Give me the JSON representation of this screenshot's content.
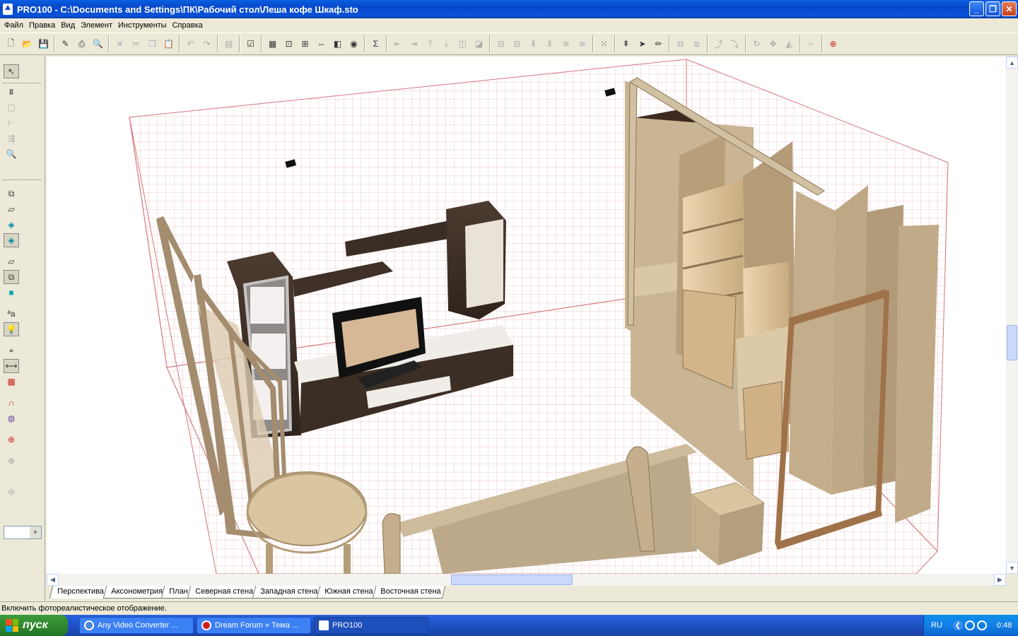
{
  "window": {
    "title": "PRO100 - C:\\Documents and Settings\\ПК\\Рабочий стол\\Леша кофе Шкаф.sto",
    "min_glyph": "_",
    "max_glyph": "❐",
    "close_glyph": "✕"
  },
  "menu": [
    "Файл",
    "Правка",
    "Вид",
    "Элемент",
    "Инструменты",
    "Справка"
  ],
  "view_tabs": [
    {
      "label": "Перспектива",
      "active": true
    },
    {
      "label": "Аксонометрия",
      "active": false
    },
    {
      "label": "План",
      "active": false
    },
    {
      "label": "Северная стена",
      "active": false
    },
    {
      "label": "Западная стена",
      "active": false
    },
    {
      "label": "Южная стена",
      "active": false
    },
    {
      "label": "Восточная стена",
      "active": false
    }
  ],
  "status": {
    "text": "Включить фотореалистическое отображение."
  },
  "taskbar": {
    "start_label": "пуск",
    "tasks": [
      {
        "label": "Any Video Converter ...",
        "icon_color": "#4a86d8",
        "active": false
      },
      {
        "label": "Dream Forum » Тема ...",
        "icon_color": "#cc2020",
        "active": false
      },
      {
        "label": "PRO100",
        "icon_color": "#ffffff",
        "active": true
      }
    ],
    "lang": "RU",
    "clock": "0:48"
  },
  "icons": {
    "toolbar_main": [
      "new-file-icon",
      "open-folder-icon",
      "save-icon",
      "properties-icon",
      "print-icon",
      "print-preview-icon",
      "cut-icon",
      "cut2-icon",
      "copy-icon",
      "paste-icon",
      "undo-icon",
      "redo-icon",
      "library-icon",
      "checklist-icon",
      "view1-icon",
      "view2-icon",
      "view3-icon",
      "view4-icon",
      "view5-icon",
      "view6-icon",
      "sum-icon",
      "align1-icon",
      "align2-icon",
      "align3-icon",
      "align4-icon",
      "align5-icon",
      "align6-icon",
      "dist1-icon",
      "dist2-icon",
      "dist3-icon",
      "dist4-icon",
      "dist5-icon",
      "dist6-icon",
      "grid-select-icon",
      "move-up-icon",
      "move-icon",
      "pencil-icon",
      "group-icon",
      "ungroup-icon",
      "up-arrow-icon",
      "down-arrow-icon",
      "rotate-icon",
      "move-all-icon",
      "mirror-icon",
      "chart-icon",
      "target-icon"
    ],
    "left_tools": [
      "pointer-icon",
      "cut-wall-icon",
      "select-box-icon",
      "measure-icon",
      "align-tool-icon",
      "zoom-tool-icon",
      "cube1-icon",
      "cube2-icon",
      "cube3-icon",
      "cube4-icon",
      "cube5-icon",
      "cube6-icon",
      "cube7-icon",
      "text-icon",
      "light-icon",
      "grid-tool-icon",
      "dimension-icon",
      "grid-icon",
      "magnet-icon",
      "globe-icon",
      "target-tool-icon",
      "zoom-in-icon",
      "zoom-out-icon"
    ]
  },
  "colors": {
    "grid_line": "#f3c6c9",
    "wall_edge": "#d4767c",
    "dark_wood": "#3e3128",
    "light_wood": "#cfc0a0",
    "birch": "#d8c6a6",
    "door_frame": "#a48c6e",
    "tv_frame": "#111111",
    "tv_panel": "#d6b896"
  }
}
